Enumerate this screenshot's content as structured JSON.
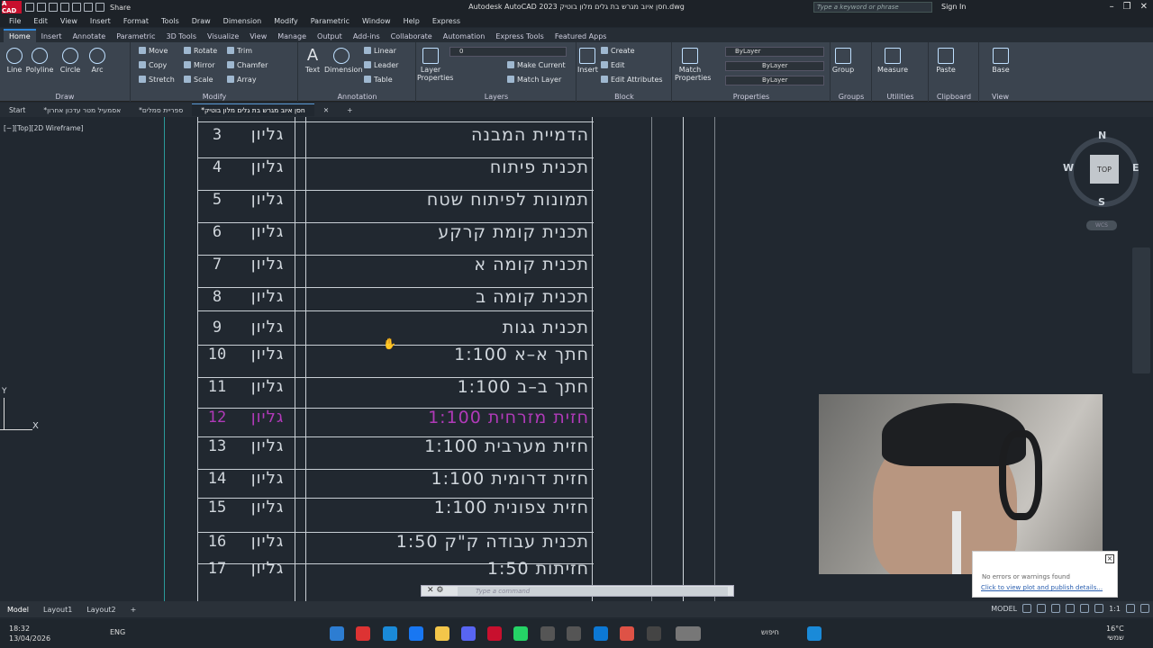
{
  "app": {
    "title": "Autodesk AutoCAD 2023  חסן איוב מגרש בת גלים מלון בוטיק.dwg",
    "logo": "A CAD",
    "share": "Share",
    "search_placeholder": "Type a keyword or phrase",
    "sign_in": "Sign In"
  },
  "menu": [
    "File",
    "Edit",
    "View",
    "Insert",
    "Format",
    "Tools",
    "Draw",
    "Dimension",
    "Modify",
    "Parametric",
    "Window",
    "Help",
    "Express"
  ],
  "ribbon_tabs": [
    {
      "label": "Home",
      "active": true
    },
    {
      "label": "Insert"
    },
    {
      "label": "Annotate"
    },
    {
      "label": "Parametric"
    },
    {
      "label": "3D Tools"
    },
    {
      "label": "Visualize"
    },
    {
      "label": "View"
    },
    {
      "label": "Manage"
    },
    {
      "label": "Output"
    },
    {
      "label": "Add-ins"
    },
    {
      "label": "Collaborate"
    },
    {
      "label": "Automation"
    },
    {
      "label": "Express Tools"
    },
    {
      "label": "Featured Apps"
    }
  ],
  "ribbon": {
    "draw": {
      "label": "Draw",
      "tools": [
        "Line",
        "Polyline",
        "Circle",
        "Arc"
      ]
    },
    "modify": {
      "label": "Modify",
      "tools": [
        "Move",
        "Rotate",
        "Trim",
        "Copy",
        "Mirror",
        "Chamfer",
        "Stretch",
        "Scale",
        "Array"
      ]
    },
    "annotation": {
      "label": "Annotation",
      "tools": [
        "Text",
        "Dimension",
        "Linear",
        "Leader",
        "Table"
      ]
    },
    "layers": {
      "label": "Layers",
      "layer_props": "Layer Properties",
      "make_current": "Make Current",
      "match_layer": "Match Layer",
      "current_layer": "0"
    },
    "block": {
      "label": "Block",
      "insert": "Insert",
      "create": "Create",
      "edit": "Edit",
      "edit_attributes": "Edit Attributes"
    },
    "properties": {
      "label": "Properties",
      "match": "Match Properties",
      "bylayer1": "ByLayer",
      "bylayer2": "ByLayer",
      "bylayer3": "ByLayer"
    },
    "groups": {
      "label": "Groups",
      "group": "Group"
    },
    "utilities": {
      "label": "Utilities",
      "measure": "Measure"
    },
    "clipboard": {
      "label": "Clipboard",
      "paste": "Paste"
    },
    "view": {
      "label": "View",
      "base": "Base"
    }
  },
  "doc_tabs": [
    {
      "label": "Start"
    },
    {
      "label": "*אסמעיל מטר עדכון אחרון"
    },
    {
      "label": "*ספריית סמלים"
    },
    {
      "label": "*חסן איוב מגרש בת גלים מלון בוטיק",
      "active": true
    }
  ],
  "viewport_label": "[−][Top][2D Wireframe]",
  "compass": {
    "n": "N",
    "s": "S",
    "e": "E",
    "w": "W",
    "top": "TOP",
    "wcs": "WCS"
  },
  "ucs": {
    "x": "X",
    "y": "Y"
  },
  "sheets": [
    {
      "num": "3",
      "label": "גליון",
      "title": "הדמיית המבנה"
    },
    {
      "num": "4",
      "label": "גליון",
      "title": "תכנית פיתוח"
    },
    {
      "num": "5",
      "label": "גליון",
      "title": "תמונות לפיתוח שטח"
    },
    {
      "num": "6",
      "label": "גליון",
      "title": "תכנית קומת קרקע"
    },
    {
      "num": "7",
      "label": "גליון",
      "title": "תכנית קומה א"
    },
    {
      "num": "8",
      "label": "גליון",
      "title": "תכנית קומה ב"
    },
    {
      "num": "9",
      "label": "גליון",
      "title": "תכנית גגות"
    },
    {
      "num": "10",
      "label": "גליון",
      "title": "חתך א–א 1:100"
    },
    {
      "num": "11",
      "label": "גליון",
      "title": "חתך ב–ב 1:100"
    },
    {
      "num": "12",
      "label": "גליון",
      "title": "חזית מזרחית 1:100",
      "color": "#b03ab8"
    },
    {
      "num": "13",
      "label": "גליון",
      "title": "חזית מערבית 1:100"
    },
    {
      "num": "14",
      "label": "גליון",
      "title": "חזית דרומית 1:100"
    },
    {
      "num": "15",
      "label": "גליון",
      "title": "חזית צפונית 1:100"
    },
    {
      "num": "16",
      "label": "גליון",
      "title": "תכנית עבודה ק\"ק 1:50"
    },
    {
      "num": "17",
      "label": "גליון",
      "title": "חזיתות 1:50"
    }
  ],
  "command": {
    "placeholder": "Type a command"
  },
  "notification": {
    "line1": "No errors or warnings found",
    "line2": "Click to view plot and publish details..."
  },
  "layout_tabs": [
    {
      "label": "Model",
      "active": true
    },
    {
      "label": "Layout1"
    },
    {
      "label": "Layout2"
    }
  ],
  "status": {
    "model": "MODEL",
    "scale": "1:1"
  },
  "taskbar": {
    "time": "18:32",
    "date": "13/04/2026",
    "lang": "ENG",
    "search": "חיפוש",
    "weather": "16°C",
    "weather_sub": "שמשי"
  }
}
